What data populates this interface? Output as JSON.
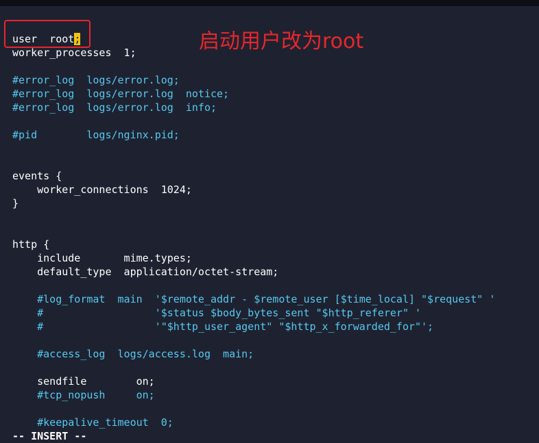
{
  "annotation": {
    "text": "启动用户改为root",
    "color": "#e8262c"
  },
  "editor": {
    "mode": "-- INSERT --",
    "colors": {
      "background": "#1e2230",
      "text": "#ffffff",
      "comment": "#56c8f0",
      "cursor": "#f1c40f"
    },
    "first_line": {
      "before_cursor": "user  root",
      "cursor_char": ";"
    },
    "lines": [
      {
        "text": "worker_processes  1;",
        "type": "normal"
      },
      {
        "text": "",
        "type": "normal"
      },
      {
        "text": "#error_log  logs/error.log;",
        "type": "comment"
      },
      {
        "text": "#error_log  logs/error.log  notice;",
        "type": "comment"
      },
      {
        "text": "#error_log  logs/error.log  info;",
        "type": "comment"
      },
      {
        "text": "",
        "type": "normal"
      },
      {
        "text": "#pid        logs/nginx.pid;",
        "type": "comment"
      },
      {
        "text": "",
        "type": "normal"
      },
      {
        "text": "",
        "type": "normal"
      },
      {
        "text": "events {",
        "type": "normal"
      },
      {
        "text": "    worker_connections  1024;",
        "type": "normal"
      },
      {
        "text": "}",
        "type": "normal"
      },
      {
        "text": "",
        "type": "normal"
      },
      {
        "text": "",
        "type": "normal"
      },
      {
        "text": "http {",
        "type": "normal"
      },
      {
        "text": "    include       mime.types;",
        "type": "normal"
      },
      {
        "text": "    default_type  application/octet-stream;",
        "type": "normal"
      },
      {
        "text": "",
        "type": "normal"
      },
      {
        "text": "    #log_format  main  '$remote_addr - $remote_user [$time_local] \"$request\" '",
        "type": "comment"
      },
      {
        "text": "    #                  '$status $body_bytes_sent \"$http_referer\" '",
        "type": "comment"
      },
      {
        "text": "    #                  '\"$http_user_agent\" \"$http_x_forwarded_for\"';",
        "type": "comment"
      },
      {
        "text": "",
        "type": "normal"
      },
      {
        "text": "    #access_log  logs/access.log  main;",
        "type": "comment"
      },
      {
        "text": "",
        "type": "normal"
      },
      {
        "text": "    sendfile        on;",
        "type": "normal"
      },
      {
        "text": "    #tcp_nopush     on;",
        "type": "comment"
      },
      {
        "text": "",
        "type": "normal"
      },
      {
        "text": "    #keepalive_timeout  0;",
        "type": "comment"
      }
    ]
  }
}
